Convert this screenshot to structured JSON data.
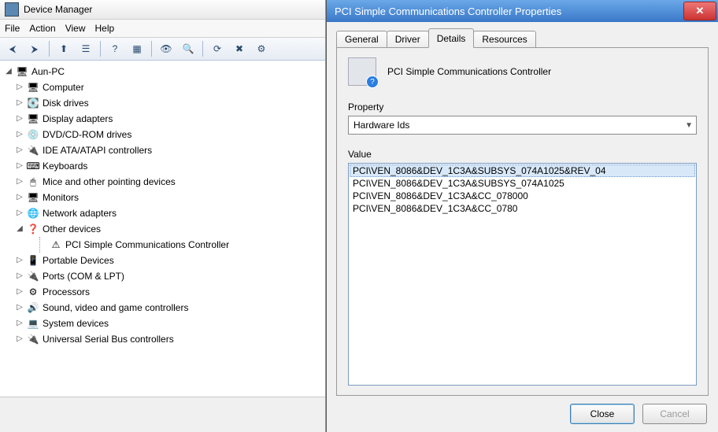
{
  "dm": {
    "title": "Device Manager",
    "menu": [
      "File",
      "Action",
      "View",
      "Help"
    ],
    "toolbar_icons": [
      "back",
      "forward",
      "up",
      "props",
      "help",
      "view",
      "show",
      "scan",
      "update",
      "uninstall",
      "disable"
    ],
    "root": "Aun-PC",
    "categories": [
      {
        "label": "Computer",
        "icon": "🖥",
        "exp": "▷"
      },
      {
        "label": "Disk drives",
        "icon": "💽",
        "exp": "▷"
      },
      {
        "label": "Display adapters",
        "icon": "🖥",
        "exp": "▷"
      },
      {
        "label": "DVD/CD-ROM drives",
        "icon": "💿",
        "exp": "▷"
      },
      {
        "label": "IDE ATA/ATAPI controllers",
        "icon": "🔌",
        "exp": "▷"
      },
      {
        "label": "Keyboards",
        "icon": "⌨",
        "exp": "▷"
      },
      {
        "label": "Mice and other pointing devices",
        "icon": "🖱",
        "exp": "▷"
      },
      {
        "label": "Monitors",
        "icon": "🖥",
        "exp": "▷"
      },
      {
        "label": "Network adapters",
        "icon": "🌐",
        "exp": "▷"
      },
      {
        "label": "Other devices",
        "icon": "❓",
        "exp": "◢",
        "child": "PCI Simple Communications Controller"
      },
      {
        "label": "Portable Devices",
        "icon": "📱",
        "exp": "▷"
      },
      {
        "label": "Ports (COM & LPT)",
        "icon": "🔌",
        "exp": "▷"
      },
      {
        "label": "Processors",
        "icon": "⚙",
        "exp": "▷"
      },
      {
        "label": "Sound, video and game controllers",
        "icon": "🔊",
        "exp": "▷"
      },
      {
        "label": "System devices",
        "icon": "💻",
        "exp": "▷"
      },
      {
        "label": "Universal Serial Bus controllers",
        "icon": "🔌",
        "exp": "▷"
      }
    ]
  },
  "dlg": {
    "title": "PCI Simple Communications Controller Properties",
    "device_name": "PCI Simple Communications Controller",
    "tabs": [
      "General",
      "Driver",
      "Details",
      "Resources"
    ],
    "active_tab": 2,
    "property_label": "Property",
    "property_value": "Hardware Ids",
    "value_label": "Value",
    "values": [
      "PCI\\VEN_8086&DEV_1C3A&SUBSYS_074A1025&REV_04",
      "PCI\\VEN_8086&DEV_1C3A&SUBSYS_074A1025",
      "PCI\\VEN_8086&DEV_1C3A&CC_078000",
      "PCI\\VEN_8086&DEV_1C3A&CC_0780"
    ],
    "close": "Close",
    "cancel": "Cancel"
  }
}
